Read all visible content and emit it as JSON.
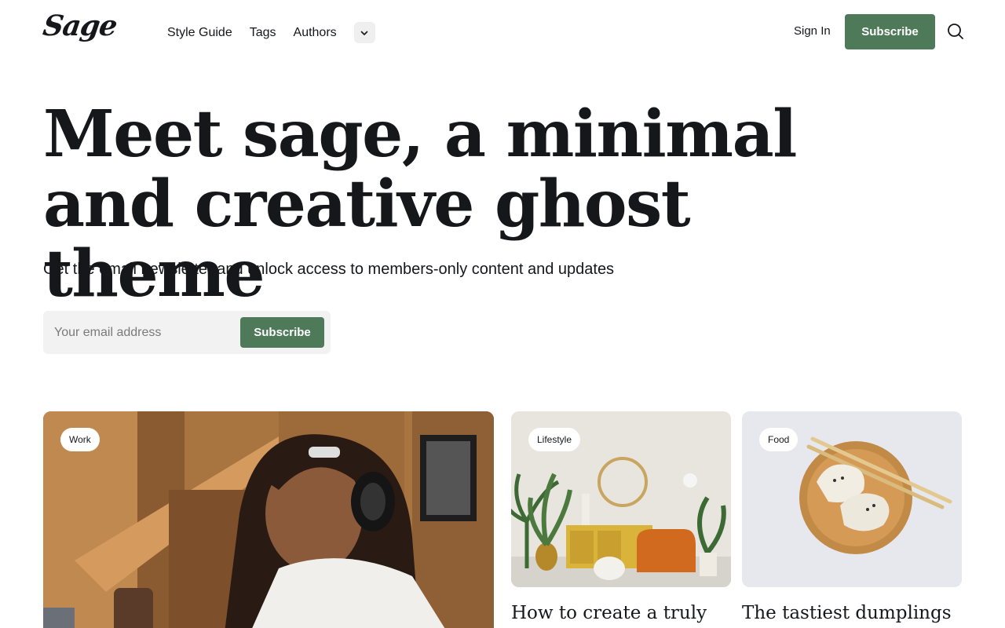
{
  "header": {
    "logo": "Sage",
    "nav": [
      "Style Guide",
      "Tags",
      "Authors"
    ],
    "more_icon": "chevron-down-icon",
    "signin": "Sign In",
    "subscribe": "Subscribe",
    "search_icon": "search-icon"
  },
  "hero": {
    "title": "Meet sage, a minimal and creative ghost theme",
    "subtitle": "Get the email newsletter and unlock access to members-only content and updates",
    "email_placeholder": "Your email address",
    "subscribe": "Subscribe"
  },
  "posts": [
    {
      "tag": "Work",
      "title": ""
    },
    {
      "tag": "Lifestyle",
      "title": "How to create a truly"
    },
    {
      "tag": "Food",
      "title": "The tastiest dumplings"
    }
  ],
  "colors": {
    "accent": "#4f7a5a",
    "text": "#15171a",
    "input_bg": "#f2f2f2"
  }
}
